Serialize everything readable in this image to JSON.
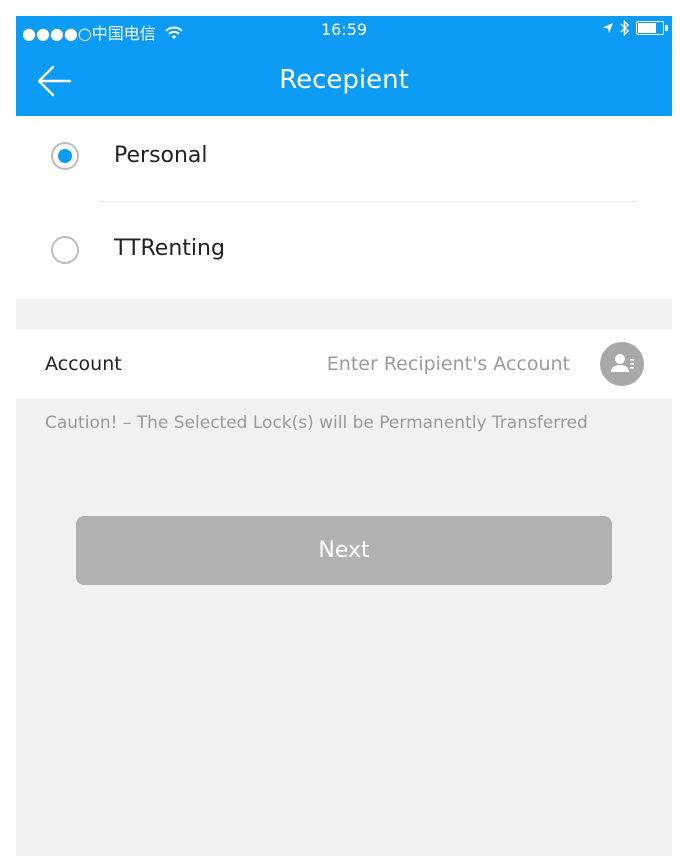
{
  "status_bar": {
    "carrier": "●●●●○中国电信",
    "time": "16:59"
  },
  "nav": {
    "title": "Recepient"
  },
  "recipient_type": {
    "options": [
      {
        "label": "Personal",
        "selected": true
      },
      {
        "label": "TTRenting",
        "selected": false
      }
    ]
  },
  "account": {
    "label": "Account",
    "value": "",
    "placeholder": "Enter Recipient's Account"
  },
  "caution": "Caution! – The Selected Lock(s) will be Permanently Transferred",
  "next_button": "Next",
  "colors": {
    "accent": "#0c9cf5",
    "background": "#f2f2f2",
    "button_disabled": "#b2b2b2"
  },
  "icons": [
    "wifi-icon",
    "location-arrow-icon",
    "bluetooth-icon",
    "battery-icon",
    "back-arrow-icon",
    "contact-book-icon"
  ]
}
